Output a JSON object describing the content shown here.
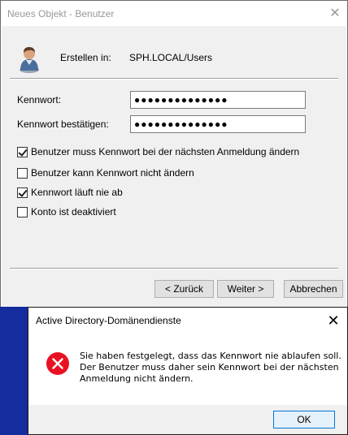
{
  "main_dialog": {
    "title": "Neues Objekt - Benutzer",
    "close_glyph": "✕",
    "create_in_label": "Erstellen in:",
    "create_in_value": "SPH.LOCAL/Users",
    "password_label": "Kennwort:",
    "password_value": "●●●●●●●●●●●●●●",
    "confirm_label": "Kennwort bestätigen:",
    "confirm_value": "●●●●●●●●●●●●●●",
    "options": [
      {
        "label": "Benutzer muss Kennwort bei der nächsten Anmeldung ändern",
        "checked": true
      },
      {
        "label": "Benutzer kann Kennwort nicht ändern",
        "checked": false
      },
      {
        "label": "Kennwort läuft nie ab",
        "checked": true
      },
      {
        "label": "Konto ist deaktiviert",
        "checked": false
      }
    ],
    "back_button": "< Zurück",
    "next_button": "Weiter >",
    "cancel_button": "Abbrechen"
  },
  "message_box": {
    "title": "Active Directory-Domänendienste",
    "close_glyph": "✕",
    "icon": "error-icon",
    "message_lines": [
      "Sie haben festgelegt, dass das Kennwort nie ablaufen soll.",
      "Der Benutzer muss daher sein Kennwort bei der nächsten",
      "Anmeldung nicht ändern."
    ],
    "ok_button": "OK"
  },
  "colors": {
    "error_red": "#e81123",
    "accent_blue": "#0078d7",
    "background_blue": "#142c9c"
  }
}
